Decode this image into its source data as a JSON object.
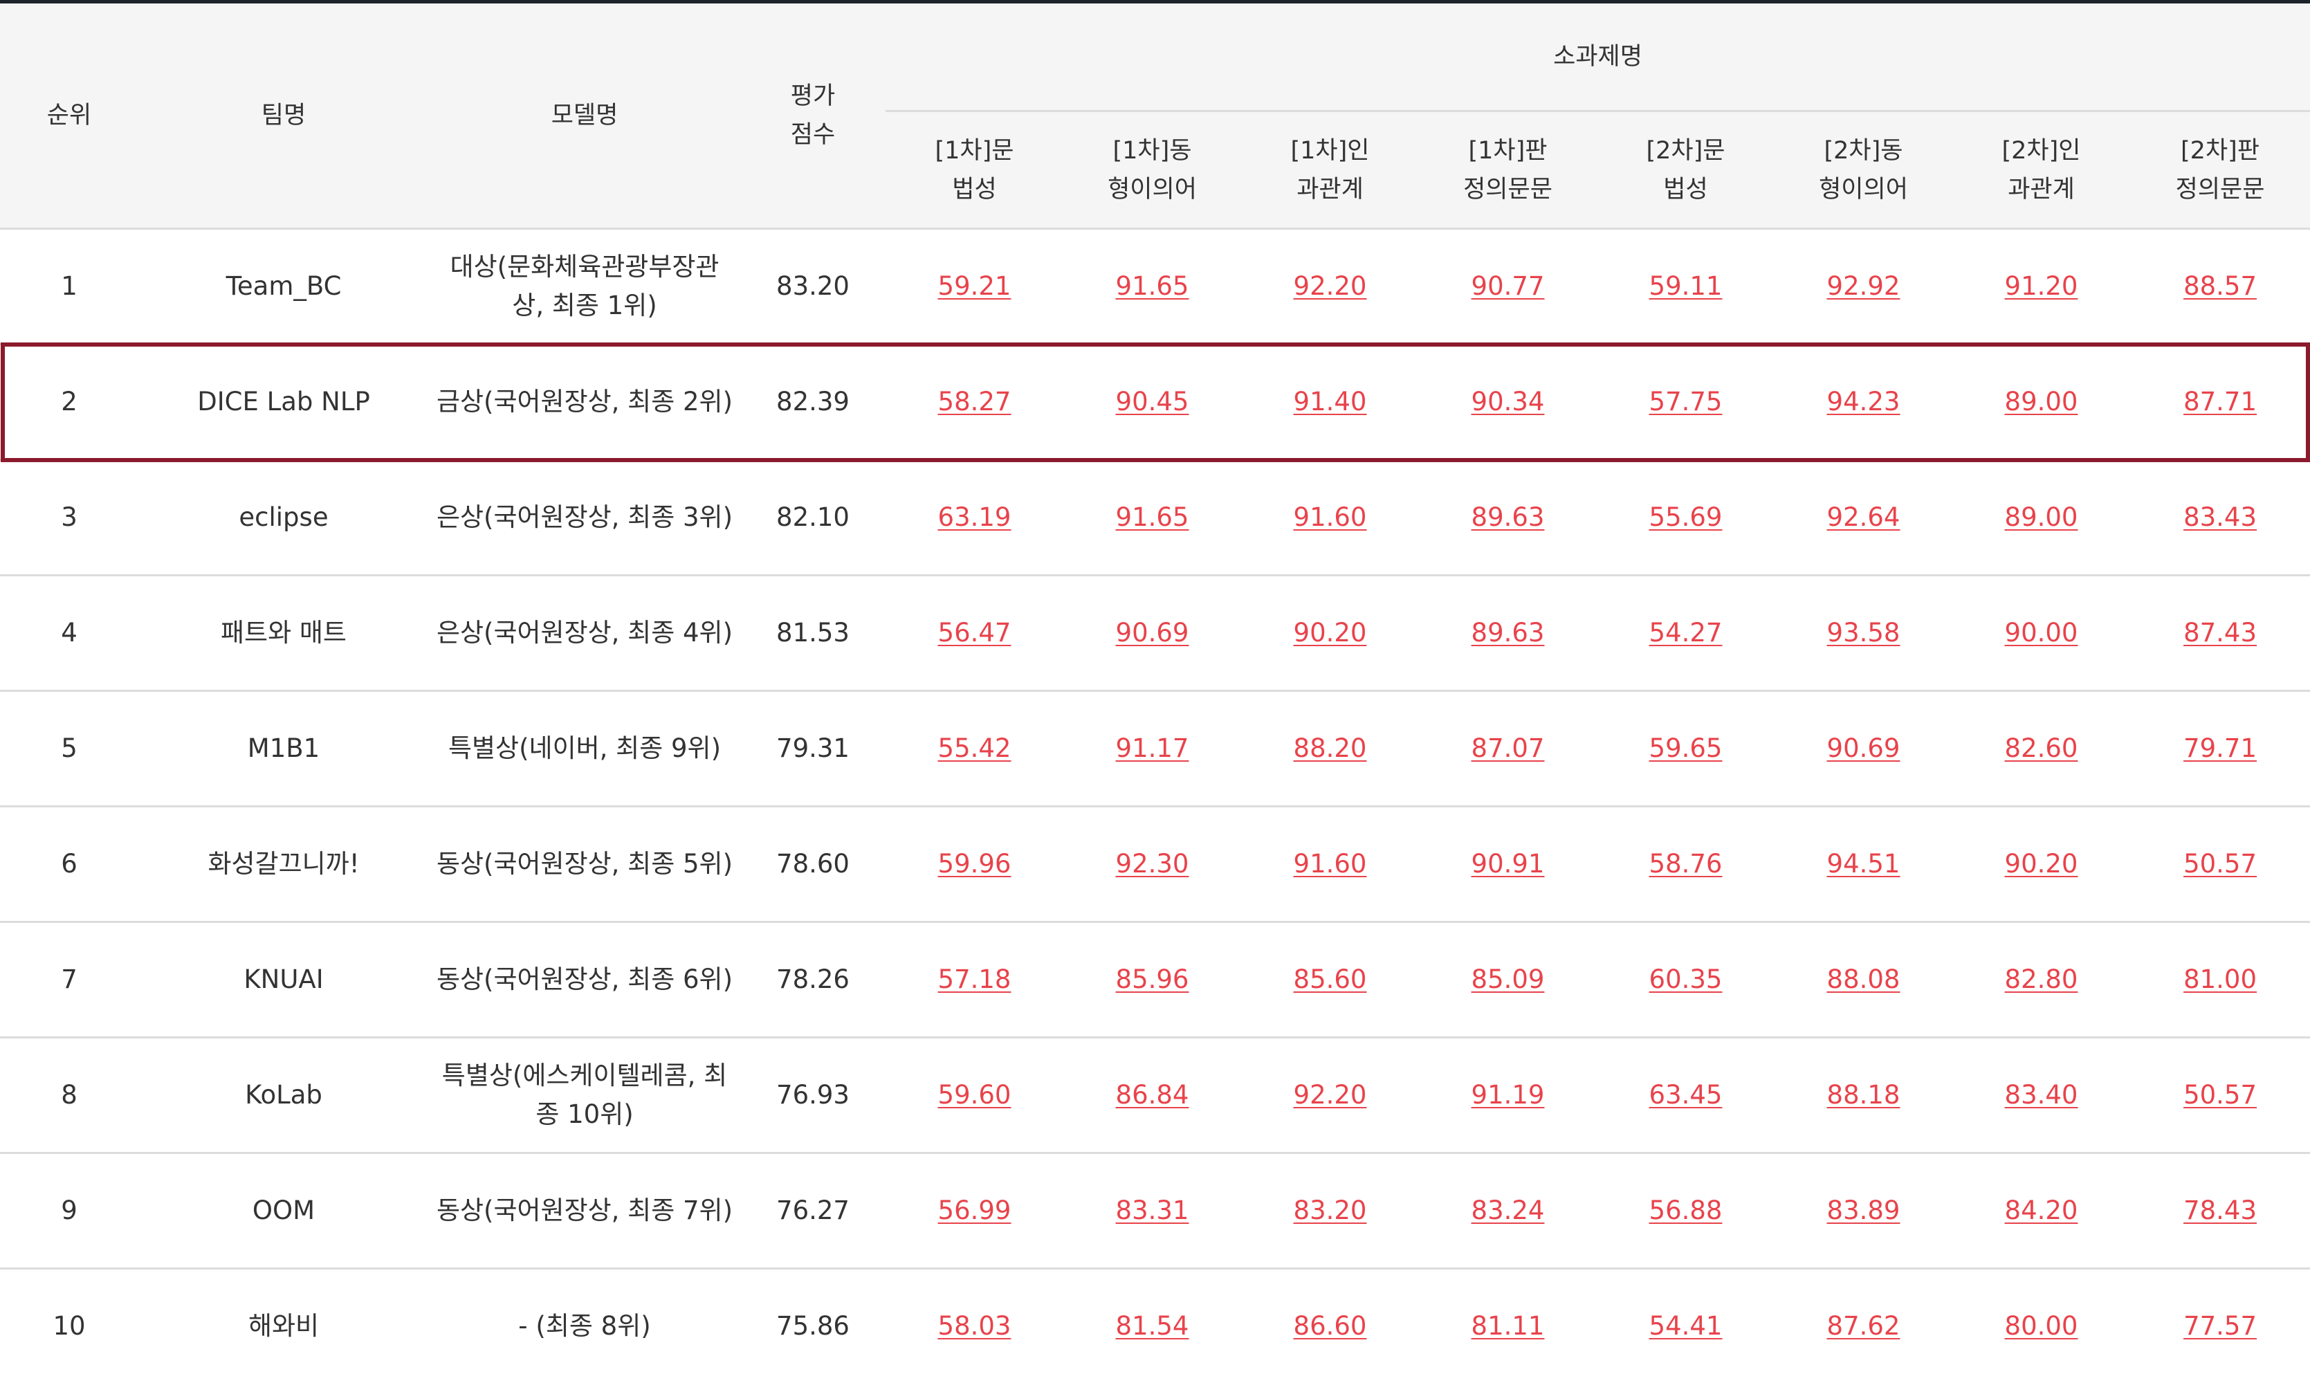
{
  "header": {
    "rank": "순위",
    "team": "팀명",
    "model": "모델명",
    "score": "평가\n점수",
    "subtasks_group": "소과제명",
    "subtasks": [
      "[1차]문\n법성",
      "[1차]동\n형이의어",
      "[1차]인\n과관계",
      "[1차]판\n정의문문",
      "[2차]문\n법성",
      "[2차]동\n형이의어",
      "[2차]인\n과관계",
      "[2차]판\n정의문문"
    ]
  },
  "rows": [
    {
      "rank": "1",
      "team": "Team_BC",
      "model": "대상(문화체육관광부장관\n상, 최종 1위)",
      "score": "83.20",
      "subscores": [
        "59.21",
        "91.65",
        "92.20",
        "90.77",
        "59.11",
        "92.92",
        "91.20",
        "88.57"
      ]
    },
    {
      "rank": "2",
      "team": "DICE Lab NLP",
      "model": "금상(국어원장상, 최종 2위)",
      "score": "82.39",
      "subscores": [
        "58.27",
        "90.45",
        "91.40",
        "90.34",
        "57.75",
        "94.23",
        "89.00",
        "87.71"
      ]
    },
    {
      "rank": "3",
      "team": "eclipse",
      "model": "은상(국어원장상, 최종 3위)",
      "score": "82.10",
      "subscores": [
        "63.19",
        "91.65",
        "91.60",
        "89.63",
        "55.69",
        "92.64",
        "89.00",
        "83.43"
      ]
    },
    {
      "rank": "4",
      "team": "패트와 매트",
      "model": "은상(국어원장상, 최종 4위)",
      "score": "81.53",
      "subscores": [
        "56.47",
        "90.69",
        "90.20",
        "89.63",
        "54.27",
        "93.58",
        "90.00",
        "87.43"
      ]
    },
    {
      "rank": "5",
      "team": "M1B1",
      "model": "특별상(네이버, 최종 9위)",
      "score": "79.31",
      "subscores": [
        "55.42",
        "91.17",
        "88.20",
        "87.07",
        "59.65",
        "90.69",
        "82.60",
        "79.71"
      ]
    },
    {
      "rank": "6",
      "team": "화성갈끄니까!",
      "model": "동상(국어원장상, 최종 5위)",
      "score": "78.60",
      "subscores": [
        "59.96",
        "92.30",
        "91.60",
        "90.91",
        "58.76",
        "94.51",
        "90.20",
        "50.57"
      ]
    },
    {
      "rank": "7",
      "team": "KNUAI",
      "model": "동상(국어원장상, 최종 6위)",
      "score": "78.26",
      "subscores": [
        "57.18",
        "85.96",
        "85.60",
        "85.09",
        "60.35",
        "88.08",
        "82.80",
        "81.00"
      ]
    },
    {
      "rank": "8",
      "team": "KoLab",
      "model": "특별상(에스케이텔레콤, 최\n종 10위)",
      "score": "76.93",
      "subscores": [
        "59.60",
        "86.84",
        "92.20",
        "91.19",
        "63.45",
        "88.18",
        "83.40",
        "50.57"
      ]
    },
    {
      "rank": "9",
      "team": "OOM",
      "model": "동상(국어원장상, 최종 7위)",
      "score": "76.27",
      "subscores": [
        "56.99",
        "83.31",
        "83.20",
        "83.24",
        "56.88",
        "83.89",
        "84.20",
        "78.43"
      ]
    },
    {
      "rank": "10",
      "team": "해와비",
      "model": "- (최종 8위)",
      "score": "75.86",
      "subscores": [
        "58.03",
        "81.54",
        "86.60",
        "81.11",
        "54.41",
        "87.62",
        "80.00",
        "77.57"
      ]
    }
  ],
  "highlighted_rank": "2",
  "colors": {
    "score_text": "#e8434b",
    "header_bg": "#f5f5f5",
    "highlight_border": "#8b1a2d",
    "top_border": "#1d232b"
  }
}
